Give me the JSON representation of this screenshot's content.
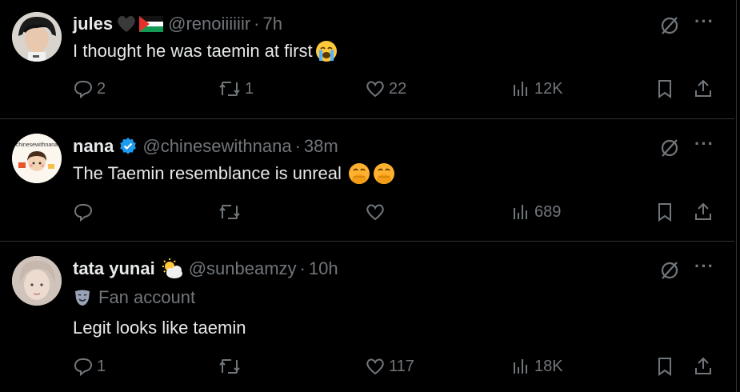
{
  "tweets": [
    {
      "name": "jules",
      "handle": "@renoiiiiiir",
      "time": "7h",
      "text": "I thought he was taemin at first",
      "replies": "2",
      "retweets": "1",
      "likes": "22",
      "views": "12K"
    },
    {
      "name": "nana",
      "handle": "@chinesewithnana",
      "time": "38m",
      "text": "The Taemin resemblance is unreal",
      "replies": "",
      "retweets": "",
      "likes": "",
      "views": "689",
      "avatar_label": "chinesewithnana"
    },
    {
      "name": "tata yunai",
      "handle": "@sunbeamzy",
      "time": "10h",
      "label": "Fan account",
      "text": "Legit looks like taemin",
      "replies": "1",
      "retweets": "",
      "likes": "117",
      "views": "18K"
    }
  ],
  "separator": "·",
  "more_glyph": "···",
  "colors": {
    "background": "#000000",
    "text": "#e7e9ea",
    "muted": "#71767b",
    "divider": "#2f3336",
    "verified": "#1d9bf0"
  }
}
